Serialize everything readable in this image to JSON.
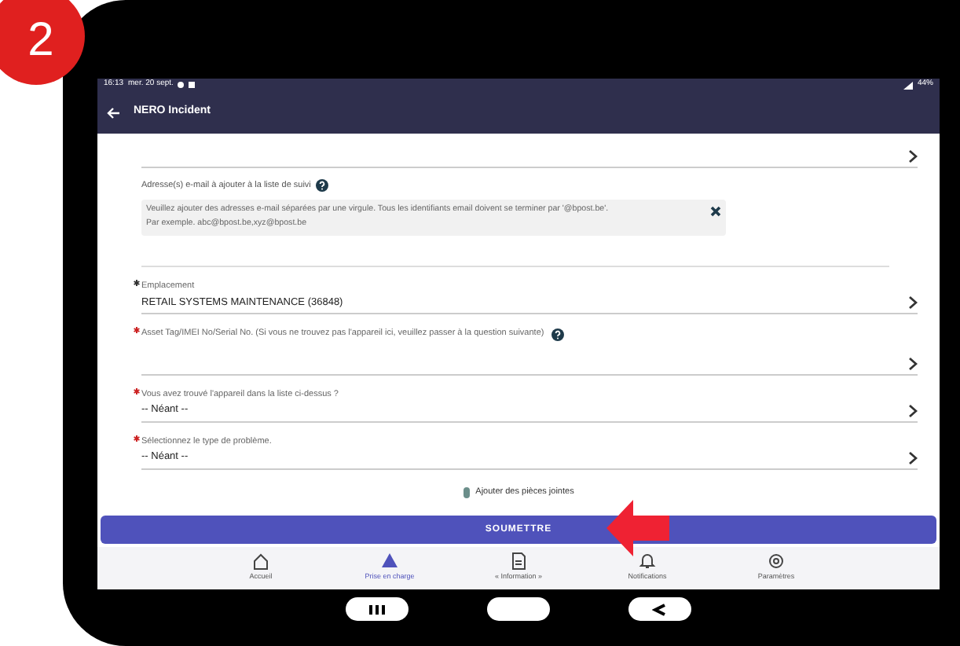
{
  "step_badge": "2",
  "status_bar": {
    "time": "16:13",
    "date": "mer. 20 sept.",
    "battery": "44%"
  },
  "app_bar": {
    "title": "NERO Incident"
  },
  "fields": [
    {
      "kind": "select",
      "required": false,
      "help": false
    },
    {
      "kind": "note",
      "label": "Adresse(s) e-mail à ajouter à la liste de suivi",
      "required": false,
      "help": true,
      "lines": [
        "Veuillez ajouter des adresses e-mail séparées par une virgule. Tous les identifiants email doivent se terminer par '@bpost.be'.",
        "Par exemple. abc@bpost.be,xyz@bpost.be"
      ]
    },
    {
      "kind": "select",
      "label": "Emplacement",
      "required": true,
      "color": "#333333",
      "help": false,
      "value": "RETAIL SYSTEMS MAINTENANCE (36848)"
    },
    {
      "kind": "select",
      "label": "Asset Tag/IMEI No/Serial No. (Si vous ne trouvez pas l'appareil ici, veuillez passer à la question suivante)",
      "required": true,
      "color": "#cc2222",
      "help": true
    },
    {
      "kind": "select",
      "label": "Vous avez trouvé l'appareil dans la liste ci-dessus ?",
      "required": true,
      "color": "#cc2222",
      "help": false,
      "value": "-- Néant --"
    },
    {
      "kind": "select",
      "label": "Sélectionnez le type de problème.",
      "required": true,
      "color": "#cc2222",
      "help": false,
      "value": "-- Néant --"
    }
  ],
  "attachments": {
    "label": "Ajouter des pièces jointes"
  },
  "submit": {
    "label": "SOUMETTRE"
  },
  "bottom_nav": [
    {
      "kind": "home",
      "label": "Accueil",
      "selected": false
    },
    {
      "kind": "warning",
      "label": "Prise en charge",
      "selected": true
    },
    {
      "kind": "document",
      "label": "« Information »",
      "selected": false
    },
    {
      "kind": "bell",
      "label": "Notifications",
      "selected": false
    },
    {
      "kind": "gear",
      "label": "Paramètres",
      "selected": false
    }
  ]
}
